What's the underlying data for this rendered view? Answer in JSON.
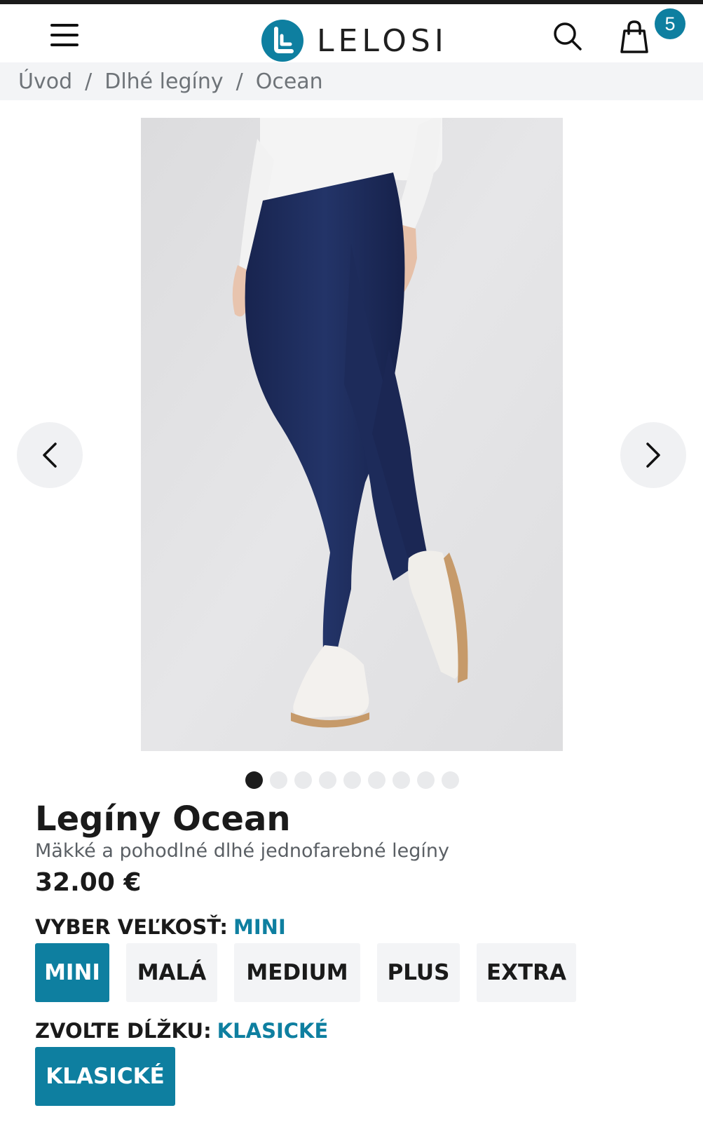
{
  "header": {
    "brand": "LELOSI",
    "cart_count": "5",
    "icons": [
      "menu-icon",
      "search-icon",
      "shopping-bag-icon"
    ],
    "accent_color": "#0e7fa0"
  },
  "breadcrumb": [
    {
      "label": "Úvod"
    },
    {
      "label": "Dlhé legíny"
    },
    {
      "label": "Ocean"
    }
  ],
  "breadcrumb_separator": "/",
  "gallery": {
    "image_alt": "Navy blue leggings with white top and sneakers",
    "slide_count": 9,
    "active_slide": 1
  },
  "product": {
    "title": "Legíny Ocean",
    "subtitle": "Mäkké a pohodlné dlhé jednofarebné legíny",
    "price": "32.00 €"
  },
  "size_selector": {
    "label": "VYBER VEĽKOSŤ:",
    "selected": "MINI",
    "options": [
      "MINI",
      "MALÁ",
      "MEDIUM",
      "PLUS",
      "EXTRA"
    ]
  },
  "length_selector": {
    "label": "ZVOĽTE DĹŽKU:",
    "selected": "KLASICKÉ",
    "options": [
      "KLASICKÉ"
    ]
  }
}
